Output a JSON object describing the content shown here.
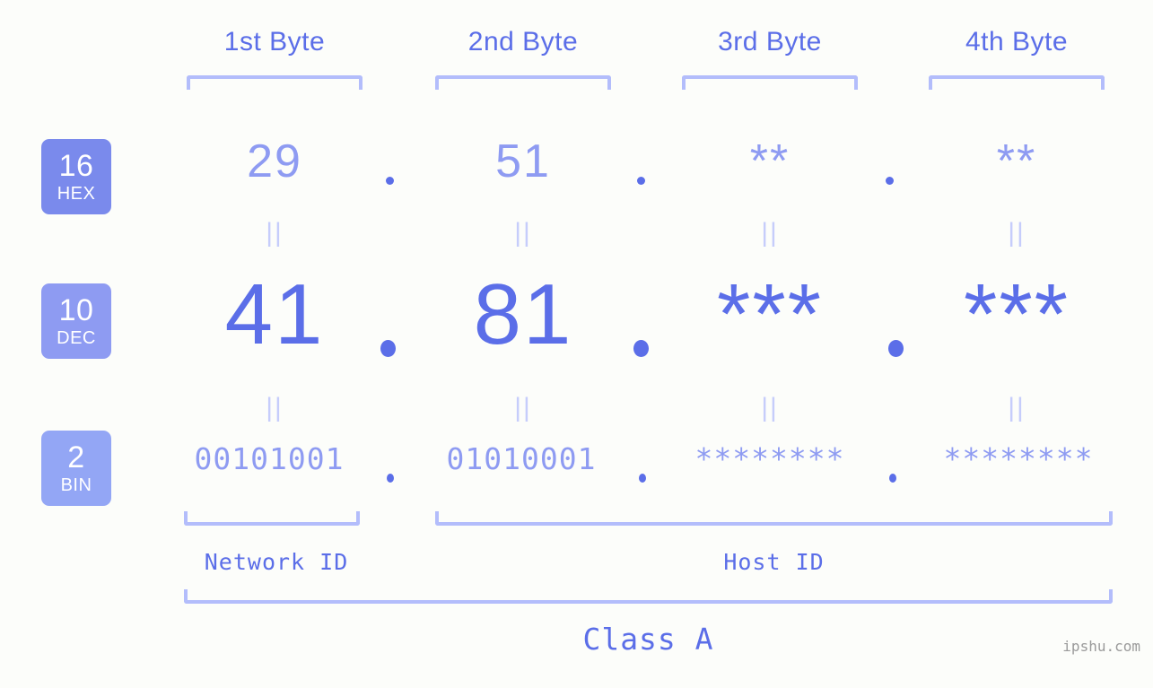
{
  "watermark": "ipshu.com",
  "columns": [
    {
      "header": "1st Byte",
      "hex": "29",
      "dec": "41",
      "bin": "00101001"
    },
    {
      "header": "2nd Byte",
      "hex": "51",
      "dec": "81",
      "bin": "01010001"
    },
    {
      "header": "3rd Byte",
      "hex": "**",
      "dec": "***",
      "bin": "********"
    },
    {
      "header": "4th Byte",
      "hex": "**",
      "dec": "***",
      "bin": "********"
    }
  ],
  "radix": [
    {
      "num": "16",
      "name": "HEX",
      "color": "#7a8aec"
    },
    {
      "num": "10",
      "name": "DEC",
      "color": "#8e9bf2"
    },
    {
      "num": "2",
      "name": "BIN",
      "color": "#93a6f5"
    }
  ],
  "separators": {
    "dot": ".",
    "equals": "||"
  },
  "segments": {
    "network_id": "Network ID",
    "host_id": "Host ID",
    "class": "Class A"
  },
  "colors": {
    "background": "#fcfdfa",
    "accent_strong": "#5b6ee8",
    "accent_mid": "#8e9bf2",
    "accent_light": "#b3bdfb",
    "connector": "#c6cdfb",
    "watermark": "#9a9a9a"
  }
}
